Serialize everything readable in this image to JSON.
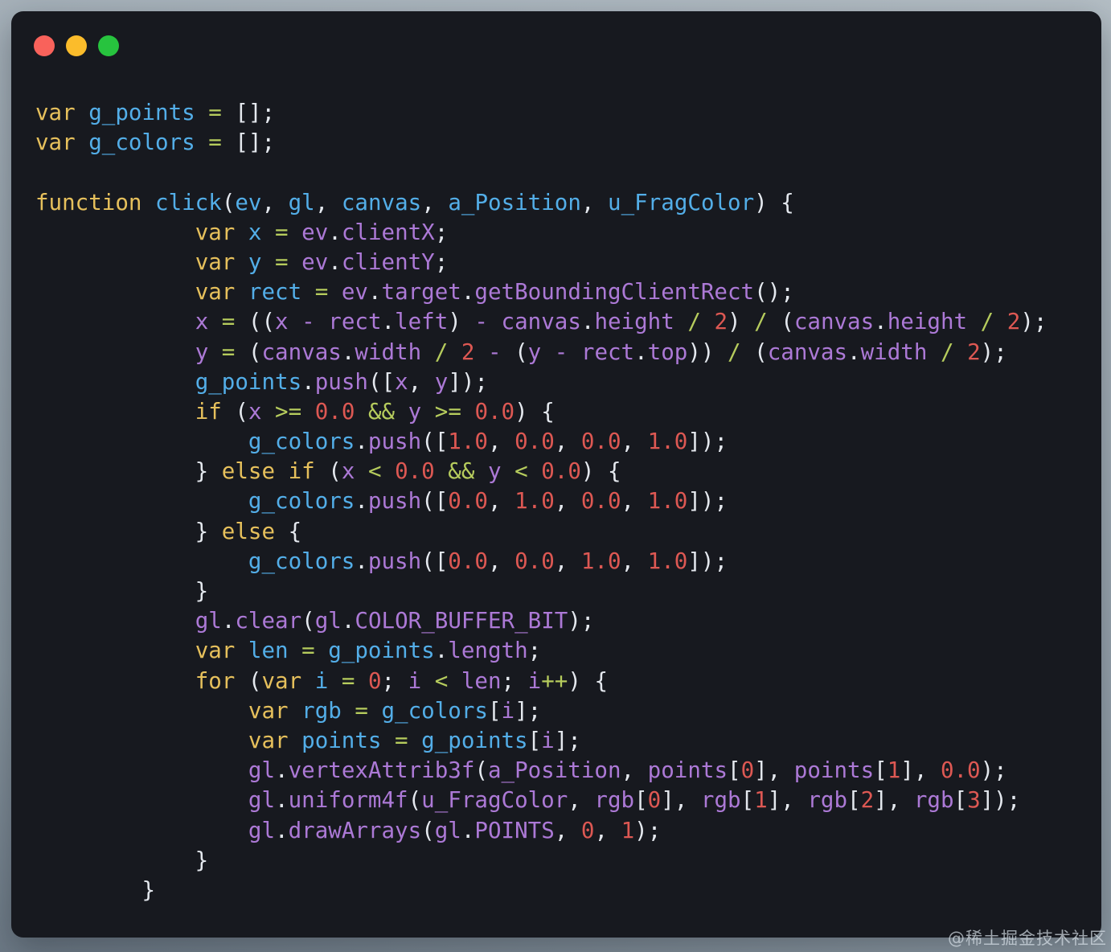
{
  "page_background": {
    "top_right": "#b4bec5",
    "middle": "#99a5af",
    "lower": "#8a97a1",
    "bottom_edge": "#6d7a86"
  },
  "window": {
    "background": "#17191f",
    "titlebar_buttons": [
      {
        "name": "close",
        "color": "#f9625b"
      },
      {
        "name": "minimize",
        "color": "#fbbc2b"
      },
      {
        "name": "maximize",
        "color": "#27c33e"
      }
    ]
  },
  "colors": {
    "tokens": {
      "kw": "#e6c05c",
      "def": "#53aee8",
      "id": "#ac79d6",
      "op": "#b6cc5d",
      "num": "#dd5853",
      "pn": "#e4e8ee"
    }
  },
  "code": {
    "language": "javascript",
    "lines": [
      [
        [
          "kw",
          "var "
        ],
        [
          "def",
          "g_points"
        ],
        [
          "op",
          " = "
        ],
        [
          "pn",
          "[];"
        ]
      ],
      [
        [
          "kw",
          "var "
        ],
        [
          "def",
          "g_colors"
        ],
        [
          "op",
          " = "
        ],
        [
          "pn",
          "[];"
        ]
      ],
      [],
      [
        [
          "kw",
          "function "
        ],
        [
          "def",
          "click"
        ],
        [
          "pn",
          "("
        ],
        [
          "def",
          "ev"
        ],
        [
          "pn",
          ", "
        ],
        [
          "def",
          "gl"
        ],
        [
          "pn",
          ", "
        ],
        [
          "def",
          "canvas"
        ],
        [
          "pn",
          ", "
        ],
        [
          "def",
          "a_Position"
        ],
        [
          "pn",
          ", "
        ],
        [
          "def",
          "u_FragColor"
        ],
        [
          "pn",
          ") {"
        ]
      ],
      [
        [
          "pn",
          "            "
        ],
        [
          "kw",
          "var "
        ],
        [
          "def",
          "x"
        ],
        [
          "op",
          " = "
        ],
        [
          "id",
          "ev"
        ],
        [
          "pn",
          "."
        ],
        [
          "id",
          "clientX"
        ],
        [
          "pn",
          ";"
        ]
      ],
      [
        [
          "pn",
          "            "
        ],
        [
          "kw",
          "var "
        ],
        [
          "def",
          "y"
        ],
        [
          "op",
          " = "
        ],
        [
          "id",
          "ev"
        ],
        [
          "pn",
          "."
        ],
        [
          "id",
          "clientY"
        ],
        [
          "pn",
          ";"
        ]
      ],
      [
        [
          "pn",
          "            "
        ],
        [
          "kw",
          "var "
        ],
        [
          "def",
          "rect"
        ],
        [
          "op",
          " = "
        ],
        [
          "id",
          "ev"
        ],
        [
          "pn",
          "."
        ],
        [
          "id",
          "target"
        ],
        [
          "pn",
          "."
        ],
        [
          "id",
          "getBoundingClientRect"
        ],
        [
          "pn",
          "();"
        ]
      ],
      [
        [
          "pn",
          "            "
        ],
        [
          "id",
          "x"
        ],
        [
          "op",
          " = "
        ],
        [
          "pn",
          "(("
        ],
        [
          "id",
          "x - rect"
        ],
        [
          "pn",
          "."
        ],
        [
          "id",
          "left"
        ],
        [
          "pn",
          ") "
        ],
        [
          "id",
          "- canvas"
        ],
        [
          "pn",
          "."
        ],
        [
          "id",
          "height"
        ],
        [
          "op",
          " / "
        ],
        [
          "num",
          "2"
        ],
        [
          "pn",
          ") "
        ],
        [
          "op",
          "/"
        ],
        [
          "pn",
          " ("
        ],
        [
          "id",
          "canvas"
        ],
        [
          "pn",
          "."
        ],
        [
          "id",
          "height"
        ],
        [
          "op",
          " / "
        ],
        [
          "num",
          "2"
        ],
        [
          "pn",
          ");"
        ]
      ],
      [
        [
          "pn",
          "            "
        ],
        [
          "id",
          "y"
        ],
        [
          "op",
          " = "
        ],
        [
          "pn",
          "("
        ],
        [
          "id",
          "canvas"
        ],
        [
          "pn",
          "."
        ],
        [
          "id",
          "width"
        ],
        [
          "op",
          " / "
        ],
        [
          "num",
          "2"
        ],
        [
          "id",
          " - "
        ],
        [
          "pn",
          "("
        ],
        [
          "id",
          "y - rect"
        ],
        [
          "pn",
          "."
        ],
        [
          "id",
          "top"
        ],
        [
          "pn",
          ")) "
        ],
        [
          "op",
          "/"
        ],
        [
          "pn",
          " ("
        ],
        [
          "id",
          "canvas"
        ],
        [
          "pn",
          "."
        ],
        [
          "id",
          "width"
        ],
        [
          "op",
          " / "
        ],
        [
          "num",
          "2"
        ],
        [
          "pn",
          ");"
        ]
      ],
      [
        [
          "pn",
          "            "
        ],
        [
          "def",
          "g_points"
        ],
        [
          "pn",
          "."
        ],
        [
          "id",
          "push"
        ],
        [
          "pn",
          "(["
        ],
        [
          "id",
          "x"
        ],
        [
          "pn",
          ", "
        ],
        [
          "id",
          "y"
        ],
        [
          "pn",
          "]);"
        ]
      ],
      [
        [
          "pn",
          "            "
        ],
        [
          "kw",
          "if"
        ],
        [
          "pn",
          " ("
        ],
        [
          "id",
          "x"
        ],
        [
          "op",
          " >= "
        ],
        [
          "num",
          "0.0"
        ],
        [
          "op",
          " && "
        ],
        [
          "id",
          "y"
        ],
        [
          "op",
          " >= "
        ],
        [
          "num",
          "0.0"
        ],
        [
          "pn",
          ") {"
        ]
      ],
      [
        [
          "pn",
          "                "
        ],
        [
          "def",
          "g_colors"
        ],
        [
          "pn",
          "."
        ],
        [
          "id",
          "push"
        ],
        [
          "pn",
          "(["
        ],
        [
          "num",
          "1.0"
        ],
        [
          "pn",
          ", "
        ],
        [
          "num",
          "0.0"
        ],
        [
          "pn",
          ", "
        ],
        [
          "num",
          "0.0"
        ],
        [
          "pn",
          ", "
        ],
        [
          "num",
          "1.0"
        ],
        [
          "pn",
          "]);"
        ]
      ],
      [
        [
          "pn",
          "            } "
        ],
        [
          "kw",
          "else if"
        ],
        [
          "pn",
          " ("
        ],
        [
          "id",
          "x"
        ],
        [
          "op",
          " < "
        ],
        [
          "num",
          "0.0"
        ],
        [
          "op",
          " && "
        ],
        [
          "id",
          "y"
        ],
        [
          "op",
          " < "
        ],
        [
          "num",
          "0.0"
        ],
        [
          "pn",
          ") {"
        ]
      ],
      [
        [
          "pn",
          "                "
        ],
        [
          "def",
          "g_colors"
        ],
        [
          "pn",
          "."
        ],
        [
          "id",
          "push"
        ],
        [
          "pn",
          "(["
        ],
        [
          "num",
          "0.0"
        ],
        [
          "pn",
          ", "
        ],
        [
          "num",
          "1.0"
        ],
        [
          "pn",
          ", "
        ],
        [
          "num",
          "0.0"
        ],
        [
          "pn",
          ", "
        ],
        [
          "num",
          "1.0"
        ],
        [
          "pn",
          "]);"
        ]
      ],
      [
        [
          "pn",
          "            } "
        ],
        [
          "kw",
          "else"
        ],
        [
          "pn",
          " {"
        ]
      ],
      [
        [
          "pn",
          "                "
        ],
        [
          "def",
          "g_colors"
        ],
        [
          "pn",
          "."
        ],
        [
          "id",
          "push"
        ],
        [
          "pn",
          "(["
        ],
        [
          "num",
          "0.0"
        ],
        [
          "pn",
          ", "
        ],
        [
          "num",
          "0.0"
        ],
        [
          "pn",
          ", "
        ],
        [
          "num",
          "1.0"
        ],
        [
          "pn",
          ", "
        ],
        [
          "num",
          "1.0"
        ],
        [
          "pn",
          "]);"
        ]
      ],
      [
        [
          "pn",
          "            }"
        ]
      ],
      [
        [
          "pn",
          "            "
        ],
        [
          "id",
          "gl"
        ],
        [
          "pn",
          "."
        ],
        [
          "id",
          "clear"
        ],
        [
          "pn",
          "("
        ],
        [
          "id",
          "gl"
        ],
        [
          "pn",
          "."
        ],
        [
          "id",
          "COLOR_BUFFER_BIT"
        ],
        [
          "pn",
          ");"
        ]
      ],
      [
        [
          "pn",
          "            "
        ],
        [
          "kw",
          "var "
        ],
        [
          "def",
          "len"
        ],
        [
          "op",
          " = "
        ],
        [
          "def",
          "g_points"
        ],
        [
          "pn",
          "."
        ],
        [
          "id",
          "length"
        ],
        [
          "pn",
          ";"
        ]
      ],
      [
        [
          "pn",
          "            "
        ],
        [
          "kw",
          "for"
        ],
        [
          "pn",
          " ("
        ],
        [
          "kw",
          "var "
        ],
        [
          "def",
          "i"
        ],
        [
          "op",
          " = "
        ],
        [
          "num",
          "0"
        ],
        [
          "pn",
          "; "
        ],
        [
          "id",
          "i"
        ],
        [
          "op",
          " < "
        ],
        [
          "id",
          "len"
        ],
        [
          "pn",
          "; "
        ],
        [
          "id",
          "i"
        ],
        [
          "op",
          "++"
        ],
        [
          "pn",
          ") {"
        ]
      ],
      [
        [
          "pn",
          "                "
        ],
        [
          "kw",
          "var "
        ],
        [
          "def",
          "rgb"
        ],
        [
          "op",
          " = "
        ],
        [
          "def",
          "g_colors"
        ],
        [
          "pn",
          "["
        ],
        [
          "id",
          "i"
        ],
        [
          "pn",
          "];"
        ]
      ],
      [
        [
          "pn",
          "                "
        ],
        [
          "kw",
          "var "
        ],
        [
          "def",
          "points"
        ],
        [
          "op",
          " = "
        ],
        [
          "def",
          "g_points"
        ],
        [
          "pn",
          "["
        ],
        [
          "id",
          "i"
        ],
        [
          "pn",
          "];"
        ]
      ],
      [
        [
          "pn",
          "                "
        ],
        [
          "id",
          "gl"
        ],
        [
          "pn",
          "."
        ],
        [
          "id",
          "vertexAttrib3f"
        ],
        [
          "pn",
          "("
        ],
        [
          "id",
          "a_Position"
        ],
        [
          "pn",
          ", "
        ],
        [
          "id",
          "points"
        ],
        [
          "pn",
          "["
        ],
        [
          "num",
          "0"
        ],
        [
          "pn",
          "], "
        ],
        [
          "id",
          "points"
        ],
        [
          "pn",
          "["
        ],
        [
          "num",
          "1"
        ],
        [
          "pn",
          "], "
        ],
        [
          "num",
          "0.0"
        ],
        [
          "pn",
          ");"
        ]
      ],
      [
        [
          "pn",
          "                "
        ],
        [
          "id",
          "gl"
        ],
        [
          "pn",
          "."
        ],
        [
          "id",
          "uniform4f"
        ],
        [
          "pn",
          "("
        ],
        [
          "id",
          "u_FragColor"
        ],
        [
          "pn",
          ", "
        ],
        [
          "id",
          "rgb"
        ],
        [
          "pn",
          "["
        ],
        [
          "num",
          "0"
        ],
        [
          "pn",
          "], "
        ],
        [
          "id",
          "rgb"
        ],
        [
          "pn",
          "["
        ],
        [
          "num",
          "1"
        ],
        [
          "pn",
          "], "
        ],
        [
          "id",
          "rgb"
        ],
        [
          "pn",
          "["
        ],
        [
          "num",
          "2"
        ],
        [
          "pn",
          "], "
        ],
        [
          "id",
          "rgb"
        ],
        [
          "pn",
          "["
        ],
        [
          "num",
          "3"
        ],
        [
          "pn",
          "]);"
        ]
      ],
      [
        [
          "pn",
          "                "
        ],
        [
          "id",
          "gl"
        ],
        [
          "pn",
          "."
        ],
        [
          "id",
          "drawArrays"
        ],
        [
          "pn",
          "("
        ],
        [
          "id",
          "gl"
        ],
        [
          "pn",
          "."
        ],
        [
          "id",
          "POINTS"
        ],
        [
          "pn",
          ", "
        ],
        [
          "num",
          "0"
        ],
        [
          "pn",
          ", "
        ],
        [
          "num",
          "1"
        ],
        [
          "pn",
          ");"
        ]
      ],
      [
        [
          "pn",
          "            }"
        ]
      ],
      [
        [
          "pn",
          "        }"
        ]
      ]
    ]
  },
  "watermark": {
    "text": "@稀土掘金技术社区",
    "color": "rgba(215,223,231,0.7)"
  }
}
